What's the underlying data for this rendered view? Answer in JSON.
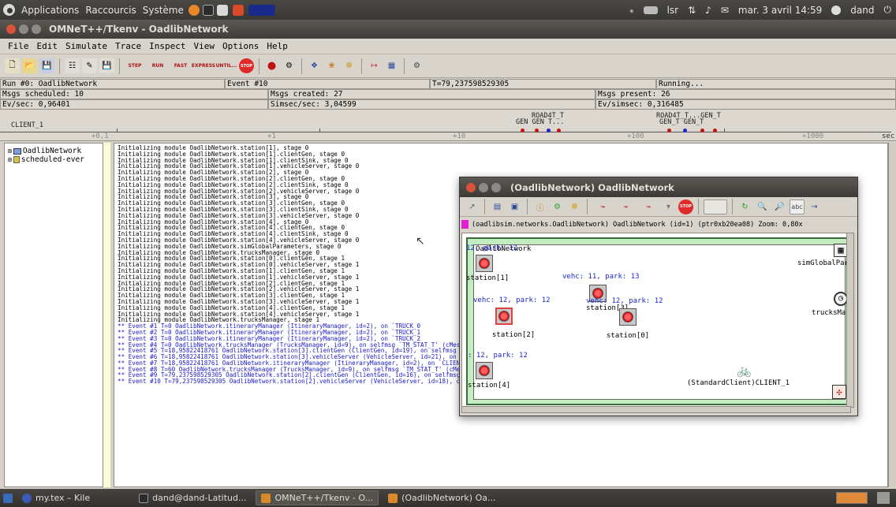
{
  "top_panel": {
    "applications": "Applications",
    "shortcuts": "Raccourcis",
    "system": "Système",
    "keyboard": "lsr",
    "datetime": "mar. 3 avril 14:59",
    "user": "dand"
  },
  "window": {
    "title": "OMNeT++/Tkenv - OadlibNetwork"
  },
  "menu": [
    "File",
    "Edit",
    "Simulate",
    "Trace",
    "Inspect",
    "View",
    "Options",
    "Help"
  ],
  "toolbar": {
    "step": "STEP",
    "run": "RUN",
    "fast": "FAST",
    "express": "EXPRESS",
    "until": "UNTIL...",
    "stop": "STOP",
    "rec": "REC"
  },
  "status": {
    "run": "Run #0: OadlibNetwork",
    "event": "Event #10",
    "time": "T=79,237598529305",
    "state": "Running...",
    "msgs_scheduled": "Msgs scheduled: 10",
    "msgs_created": "Msgs created: 27",
    "msgs_present": "Msgs present: 26",
    "ev_sec": "Ev/sec: 0,96401",
    "simsec_sec": "Simsec/sec: 3,04599",
    "ev_simsec": "Ev/simsec: 0,316485"
  },
  "timeline": {
    "left_label": "CLIENT_1",
    "ticks": [
      "+0,1",
      "+1",
      "+10",
      "+100",
      "+1000"
    ],
    "unit": "sec",
    "labels": [
      "ROAD4T_T",
      "GEN GEN T...",
      "ROAD4T_T...GEN_T",
      "GEN_T   GEN_T"
    ]
  },
  "tree": {
    "items": [
      "OadlibNetwork",
      "scheduled-ever"
    ]
  },
  "log": {
    "init_lines": [
      "Initializing module OadlibNetwork.station[1], stage 0",
      "Initializing module OadlibNetwork.station[1].clientGen, stage 0",
      "Initializing module OadlibNetwork.station[1].clientSink, stage 0",
      "Initializing module OadlibNetwork.station[1].vehicleServer, stage 0",
      "Initializing module OadlibNetwork.station[2], stage 0",
      "Initializing module OadlibNetwork.station[2].clientGen, stage 0",
      "Initializing module OadlibNetwork.station[2].clientSink, stage 0",
      "Initializing module OadlibNetwork.station[2].vehicleServer, stage 0",
      "Initializing module OadlibNetwork.station[3], stage 0",
      "Initializing module OadlibNetwork.station[3].clientGen, stage 0",
      "Initializing module OadlibNetwork.station[3].clientSink, stage 0",
      "Initializing module OadlibNetwork.station[3].vehicleServer, stage 0",
      "Initializing module OadlibNetwork.station[4], stage 0",
      "Initializing module OadlibNetwork.station[4].clientGen, stage 0",
      "Initializing module OadlibNetwork.station[4].clientSink, stage 0",
      "Initializing module OadlibNetwork.station[4].vehicleServer, stage 0",
      "Initializing module OadlibNetwork.simGlobalParameters, stage 0",
      "Initializing module OadlibNetwork.trucksManager, stage 0",
      "Initializing module OadlibNetwork.station[0].clientGen, stage 1",
      "Initializing module OadlibNetwork.station[0].vehicleServer, stage 1",
      "Initializing module OadlibNetwork.station[1].clientGen, stage 1",
      "Initializing module OadlibNetwork.station[1].vehicleServer, stage 1",
      "Initializing module OadlibNetwork.station[2].clientGen, stage 1",
      "Initializing module OadlibNetwork.station[2].vehicleServer, stage 1",
      "Initializing module OadlibNetwork.station[3].clientGen, stage 1",
      "Initializing module OadlibNetwork.station[3].vehicleServer, stage 1",
      "Initializing module OadlibNetwork.station[4].clientGen, stage 1",
      "Initializing module OadlibNetwork.station[4].vehicleServer, stage 1",
      "Initializing module OadlibNetwork.trucksManager, stage 1"
    ],
    "event_lines": [
      "** Event #1  T=0  OadlibNetwork.itineraryManager (ItineraryManager, id=2), on `TRUCK_0",
      "** Event #2  T=0  OadlibNetwork.itineraryManager (ItineraryManager, id=2), on `TRUCK_1",
      "** Event #3  T=0  OadlibNetwork.itineraryManager (ItineraryManager, id=2), on `TRUCK_2",
      "** Event #4  T=0  OadlibNetwork.trucksManager (TrucksManager, id=9), on selfmsg `TM_STAT_T' (cMessage, id=19)",
      "** Event #5  T=18,95822418761  OadlibNetwork.station[3].clientGen (ClientGen, id=19), on selfmsg `GEN_T' (cMessage, id=23)",
      "** Event #6  T=18,95822418761  OadlibNetwork.station[3].vehicleServer (VehicleServer, id=21), on `CLIENT_0' (StandardClient, id=25)",
      "** Event #7  T=18,95822418761  OadlibNetwork.itineraryManager (ItineraryManager, id=2), on `CLIENT_0' (StandardClient, id=25)",
      "** Event #8  T=60  OadlibNetwork.trucksManager (TrucksManager, id=9), on selfmsg `TM_STAT_T' (cMessage, id=19)",
      "** Event #9  T=79,237598529305  OadlibNetwork.station[2].clientGen (ClientGen, id=16), on selfmsg `GEN_T' (cMessage, id=22)",
      "** Event #10  T=79,237598529305  OadlibNetwork.station[2].vehicleServer (VehicleServer, id=18), on `CLIENT_1' (StandardClient, id=26)"
    ]
  },
  "inspector": {
    "title": "(OadlibNetwork) OadlibNetwork",
    "path": "(oadlibsim.networks.OadlibNetwork) OadlibNetwork  (id=1)  (ptr0xb20ea08) Zoom: 0,80x",
    "net_label": "OadlibNetwork",
    "nodes": {
      "station1": "station[1]",
      "station2": "station[2]",
      "station3": "station[3]",
      "station0": "station[0]",
      "station4": "station[4]",
      "client": "(StandardClient)CLIENT_1",
      "simglobal": "simGlobalPar",
      "trucks": "trucksMar"
    },
    "bubbles": {
      "s1": "12, park: 12",
      "s3": "vehc: 11, park: 13",
      "s2": "vehc: 12, park: 12",
      "s0": "vehc: 12, park: 12",
      "s4": ": 12, park: 12"
    }
  },
  "taskbar": {
    "items": [
      "my.tex – Kile",
      "dand@dand-Latitud...",
      "OMNeT++/Tkenv - O...",
      "(OadlibNetwork) Oa..."
    ]
  }
}
